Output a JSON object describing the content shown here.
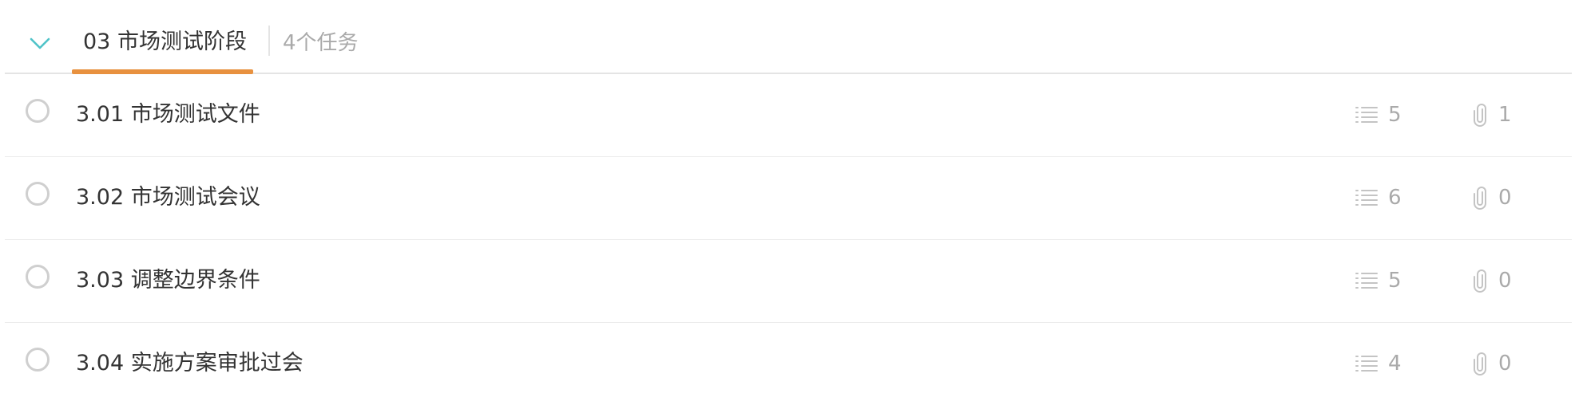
{
  "section": {
    "collapse_icon": "chevron-down-icon",
    "title": "03 市场测试阶段",
    "task_count": "4个任务",
    "accent_color": "#e8913f",
    "chevron_color": "#4fc3c8"
  },
  "tasks": [
    {
      "title": "3.01 市场测试文件",
      "subtask_count": "5",
      "attachment_count": "1",
      "completed": false
    },
    {
      "title": "3.02 市场测试会议",
      "subtask_count": "6",
      "attachment_count": "0",
      "completed": false
    },
    {
      "title": "3.03 调整边界条件",
      "subtask_count": "5",
      "attachment_count": "0",
      "completed": false
    },
    {
      "title": "3.04 实施方案审批过会",
      "subtask_count": "4",
      "attachment_count": "0",
      "completed": false
    }
  ],
  "icons": {
    "subtasks": "list-icon",
    "attachments": "paperclip-icon"
  }
}
